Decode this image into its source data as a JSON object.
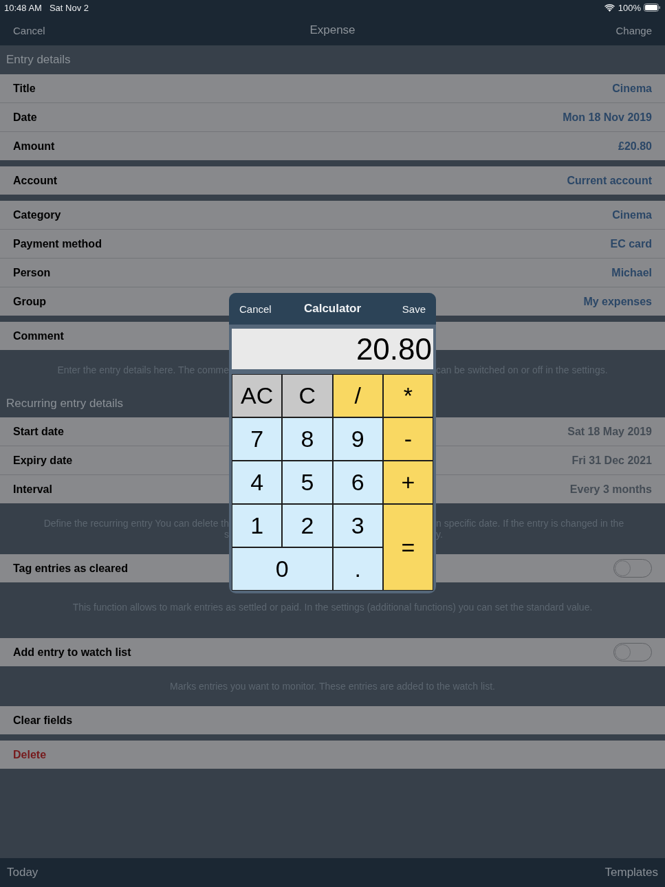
{
  "status_bar": {
    "time": "10:48 AM",
    "date": "Sat Nov 2",
    "battery": "100%"
  },
  "nav_bar": {
    "cancel": "Cancel",
    "title": "Expense",
    "change": "Change"
  },
  "form": [
    {
      "kind": "header",
      "text": "Entry details"
    },
    {
      "kind": "group",
      "rows": [
        {
          "kind": "value",
          "label": "Title",
          "value": "Cinema",
          "disabled": false
        },
        {
          "kind": "value",
          "label": "Date",
          "value": "Mon 18 Nov 2019",
          "disabled": false
        },
        {
          "kind": "value",
          "label": "Amount",
          "value": "£20.80",
          "disabled": false
        }
      ]
    },
    {
      "kind": "group",
      "rows": [
        {
          "kind": "value",
          "label": "Account",
          "value": "Current account",
          "disabled": false
        }
      ]
    },
    {
      "kind": "group",
      "rows": [
        {
          "kind": "value",
          "label": "Category",
          "value": "Cinema",
          "disabled": false
        },
        {
          "kind": "value",
          "label": "Payment method",
          "value": "EC card",
          "disabled": false
        },
        {
          "kind": "value",
          "label": "Person",
          "value": "Michael",
          "disabled": false
        },
        {
          "kind": "value",
          "label": "Group",
          "value": "My expenses",
          "disabled": false
        }
      ]
    },
    {
      "kind": "group",
      "rows": [
        {
          "kind": "label",
          "label": "Comment"
        }
      ]
    },
    {
      "kind": "footnote",
      "lines": [
        {
          "kind": "split",
          "left": "Enter the entry details here. The comme",
          "right": "can be switched on or off in the settings."
        }
      ]
    },
    {
      "kind": "header",
      "text": "Recurring entry details"
    },
    {
      "kind": "group",
      "rows": [
        {
          "kind": "value",
          "label": "Start date",
          "value": "Sat 18 May 2019",
          "disabled": true
        },
        {
          "kind": "value",
          "label": "Expiry date",
          "value": "Fri 31 Dec 2021",
          "disabled": true
        },
        {
          "kind": "value",
          "label": "Interval",
          "value": "Every 3 months",
          "disabled": true
        }
      ]
    },
    {
      "kind": "footnote",
      "lines": [
        {
          "kind": "split",
          "left": "Define the recurring entry You can delete th",
          "right": "n specific date. If the entry is changed in the"
        },
        {
          "kind": "split",
          "left": "s",
          "right": "y."
        }
      ]
    },
    {
      "kind": "group",
      "rows": [
        {
          "kind": "toggle",
          "label": "Tag entries as cleared",
          "on": false
        }
      ]
    },
    {
      "kind": "footnote",
      "lines": [
        {
          "kind": "full",
          "text": "This function allows to mark entries as settled or paid. In the settings (additional functions) you can set the standard value."
        }
      ]
    },
    {
      "kind": "group",
      "rows": [
        {
          "kind": "toggle",
          "label": "Add entry to watch list",
          "on": false
        }
      ]
    },
    {
      "kind": "footnote",
      "lines": [
        {
          "kind": "full",
          "text": "Marks entries you want to monitor. These entries are added to the watch list."
        }
      ]
    },
    {
      "kind": "group",
      "rows": [
        {
          "kind": "action",
          "label": "Clear fields"
        }
      ]
    },
    {
      "kind": "group",
      "rows": [
        {
          "kind": "destructive",
          "label": "Delete"
        }
      ]
    }
  ],
  "calculator": {
    "cancel": "Cancel",
    "title": "Calculator",
    "save": "Save",
    "display": "20.80",
    "keys": [
      {
        "label": "AC",
        "kind": "clear"
      },
      {
        "label": "C",
        "kind": "clear"
      },
      {
        "label": "/",
        "kind": "operator"
      },
      {
        "label": "*",
        "kind": "operator"
      },
      {
        "label": "7",
        "kind": "digit"
      },
      {
        "label": "8",
        "kind": "digit"
      },
      {
        "label": "9",
        "kind": "digit"
      },
      {
        "label": "-",
        "kind": "operator"
      },
      {
        "label": "4",
        "kind": "digit"
      },
      {
        "label": "5",
        "kind": "digit"
      },
      {
        "label": "6",
        "kind": "digit"
      },
      {
        "label": "+",
        "kind": "operator"
      },
      {
        "label": "1",
        "kind": "digit"
      },
      {
        "label": "2",
        "kind": "digit"
      },
      {
        "label": "3",
        "kind": "digit"
      },
      {
        "label": "=",
        "kind": "equals"
      },
      {
        "label": "0",
        "kind": "wide-digit"
      },
      {
        "label": ".",
        "kind": "digit"
      }
    ]
  },
  "toolbar": {
    "today": "Today",
    "templates": "Templates"
  }
}
